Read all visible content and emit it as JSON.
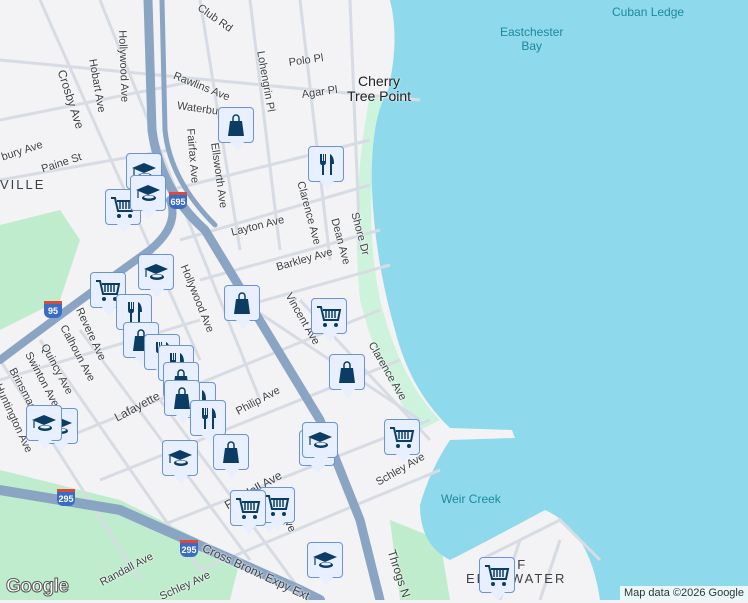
{
  "map": {
    "water_labels": {
      "eastchester_bay": "Eastchester\nBay",
      "weir_creek": "Weir Creek",
      "cuban_ledge": "Cuban Ledge"
    },
    "places": {
      "cherry_tree_point": "Cherry\nTree Point",
      "edgewater": "OF\nEDGEWATER",
      "hood_ville": "VILLE"
    },
    "streets": {
      "club_rd": "Club Rd",
      "lohengrin": "Lohengrin Pl",
      "polo": "Polo Pl",
      "agar": "Agar Pl",
      "rawlins": "Rawlins Ave",
      "waterbury": "Waterbury",
      "hobart": "Hobart Ave",
      "hollywood_n": "Hollywood Ave",
      "crosby": "Crosby Ave",
      "paine": "Paine St",
      "bury": "bury Ave",
      "fairfax": "Fairfax Ave",
      "ellsworth": "Ellsworth Ave",
      "layton": "Layton Ave",
      "barkley": "Barkley Ave",
      "clarence_n": "Clarence Ave",
      "dean": "Dean Ave",
      "shore": "Shore Dr",
      "hollywood_s": "Hollywood Ave",
      "vincent": "Vincent Ave",
      "clarence_s": "Clarence Ave",
      "revere": "Revere Ave",
      "calhoun": "Calhoun Ave",
      "quincy": "Quincy Ave",
      "swinton": "Swinton Ave",
      "brinsmade": "Brinsmade",
      "huntington": "Huntington Ave",
      "lafayette": "Lafayette",
      "philip": "Philip Ave",
      "randall": "Randall Ave",
      "randall_sw": "Randall Ave",
      "schley": "Schley Ave",
      "schley_sw": "Schley Ave",
      "cross_bronx": "Cross Bronx Expy Ext",
      "throgs": "Throgs N",
      "ave": "Ave"
    },
    "shields": {
      "i695": "695",
      "i95": "95",
      "i295a": "295",
      "i295b": "295"
    },
    "markers": [
      "shopping",
      "restaurant",
      "school",
      "grocery",
      "school",
      "grocery",
      "restaurant",
      "shopping",
      "grocery",
      "shopping",
      "restaurant",
      "restaurant",
      "shopping",
      "restaurant",
      "shopping",
      "restaurant",
      "shopping",
      "school",
      "school",
      "school",
      "grocery",
      "grocery",
      "school",
      "school",
      "shopping",
      "grocery",
      "school",
      "grocery",
      "grocery",
      "school"
    ],
    "colors": {
      "water": "#8fd9ec",
      "land": "#f3f2f4",
      "park": "#bfeccd",
      "highway": "#8aa4c4",
      "marker_fill": "#e8efff",
      "marker_icon": "#0b3d64"
    }
  },
  "footer": {
    "logo": "Google",
    "attribution": "Map data ©2026 Google"
  }
}
